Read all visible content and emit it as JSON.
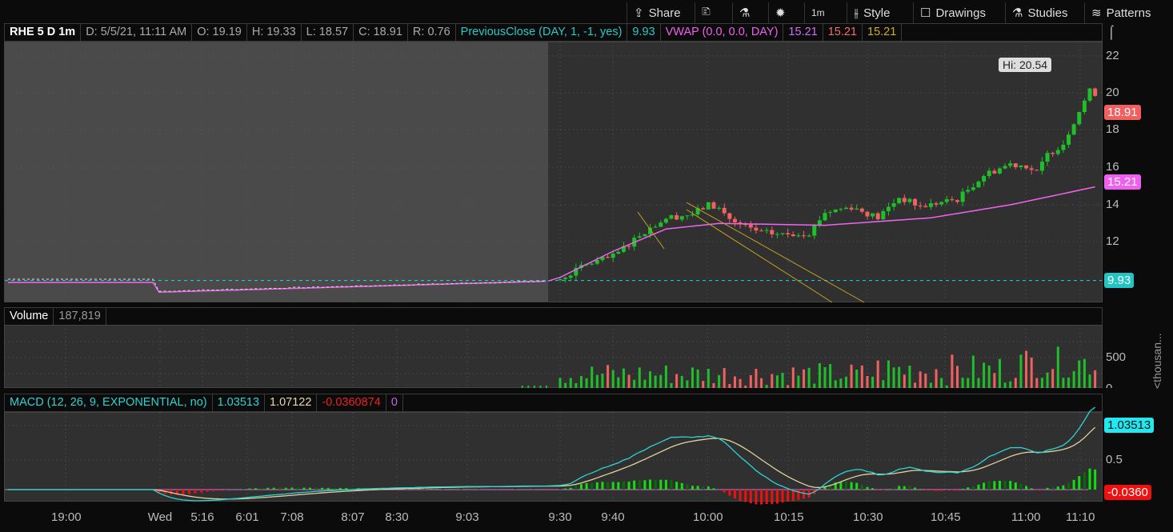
{
  "toolbar": {
    "share": "Share",
    "aggregation": "1m",
    "style": "Style",
    "drawings": "Drawings",
    "studies": "Studies",
    "patterns": "Patterns"
  },
  "header": {
    "symbol": "RHE 5 D 1m",
    "date": "D: 5/5/21, 11:11 AM",
    "open": "O: 19.19",
    "high": "H: 19.33",
    "low": "L: 18.57",
    "close": "C: 18.91",
    "range": "R: 0.76",
    "prev_close_study": "PreviousClose (DAY, 1, -1, yes)",
    "prev_close_value": "9.93",
    "vwap_study": "VWAP (0.0, 0.0, DAY)",
    "vwap_v1": "15.21",
    "vwap_v2": "15.21",
    "vwap_v3": "15.21"
  },
  "price_axis": [
    "22",
    "20",
    "18",
    "16",
    "14",
    "12"
  ],
  "price_tags": {
    "last": "18.91",
    "vwap": "15.21",
    "prev_close": "9.93",
    "hi_bubble": "Hi: 20.54"
  },
  "volume": {
    "label": "Volume",
    "value": "187,819",
    "axis": [
      "500",
      "0"
    ],
    "unit": "<thousan..."
  },
  "macd": {
    "label": "MACD (12, 26, 9, EXPONENTIAL, no)",
    "value": "1.03513",
    "avg": "1.07122",
    "diff": "-0.0360874",
    "zero": "0",
    "axis": [
      "0.5"
    ],
    "tag_value": "1.03513",
    "tag_diff": "-0.0360"
  },
  "time_axis": [
    "19:00",
    "Wed",
    "5:16",
    "6:01",
    "7:08",
    "8:07",
    "8:30",
    "9:03",
    "9:30",
    "9:40",
    "10:00",
    "10:15",
    "10:30",
    "10:45",
    "11:00",
    "11:10"
  ],
  "chart_data": {
    "type": "candlestick",
    "session_keypoints": [
      [
        0,
        10.0
      ],
      [
        5,
        10.8
      ],
      [
        10,
        11.2
      ],
      [
        15,
        12.4
      ],
      [
        20,
        13.3
      ],
      [
        25,
        13.5
      ],
      [
        28,
        14.0
      ],
      [
        30,
        13.8
      ],
      [
        33,
        13.0
      ],
      [
        38,
        12.5
      ],
      [
        42,
        12.4
      ],
      [
        47,
        12.5
      ],
      [
        50,
        13.6
      ],
      [
        55,
        13.9
      ],
      [
        60,
        13.3
      ],
      [
        64,
        14.4
      ],
      [
        68,
        13.9
      ],
      [
        75,
        14.3
      ],
      [
        80,
        15.6
      ],
      [
        85,
        16.2
      ],
      [
        88,
        16.1
      ],
      [
        90,
        15.7
      ],
      [
        92,
        16.7
      ],
      [
        95,
        17.3
      ],
      [
        97,
        18.5
      ],
      [
        99,
        19.6
      ],
      [
        100,
        20.1
      ],
      [
        102,
        19.9
      ],
      [
        104,
        19.3
      ],
      [
        105,
        18.91
      ]
    ],
    "vwap_keypoints": [
      [
        0,
        10.1
      ],
      [
        10,
        11.5
      ],
      [
        20,
        12.7
      ],
      [
        30,
        13.0
      ],
      [
        50,
        12.9
      ],
      [
        70,
        13.3
      ],
      [
        85,
        14.0
      ],
      [
        95,
        14.6
      ],
      [
        105,
        15.21
      ]
    ],
    "previous_close": 9.93,
    "high": 20.54,
    "last": 18.91,
    "ylim": [
      9,
      22.5
    ]
  },
  "colors": {
    "up": "#1fbf2a",
    "down": "#f26060",
    "vwap": "#f065f0",
    "prev": "#2ad4d4",
    "macd": "#2ad4d4",
    "avg": "#e0d3a0",
    "trend": "#c8a020"
  }
}
